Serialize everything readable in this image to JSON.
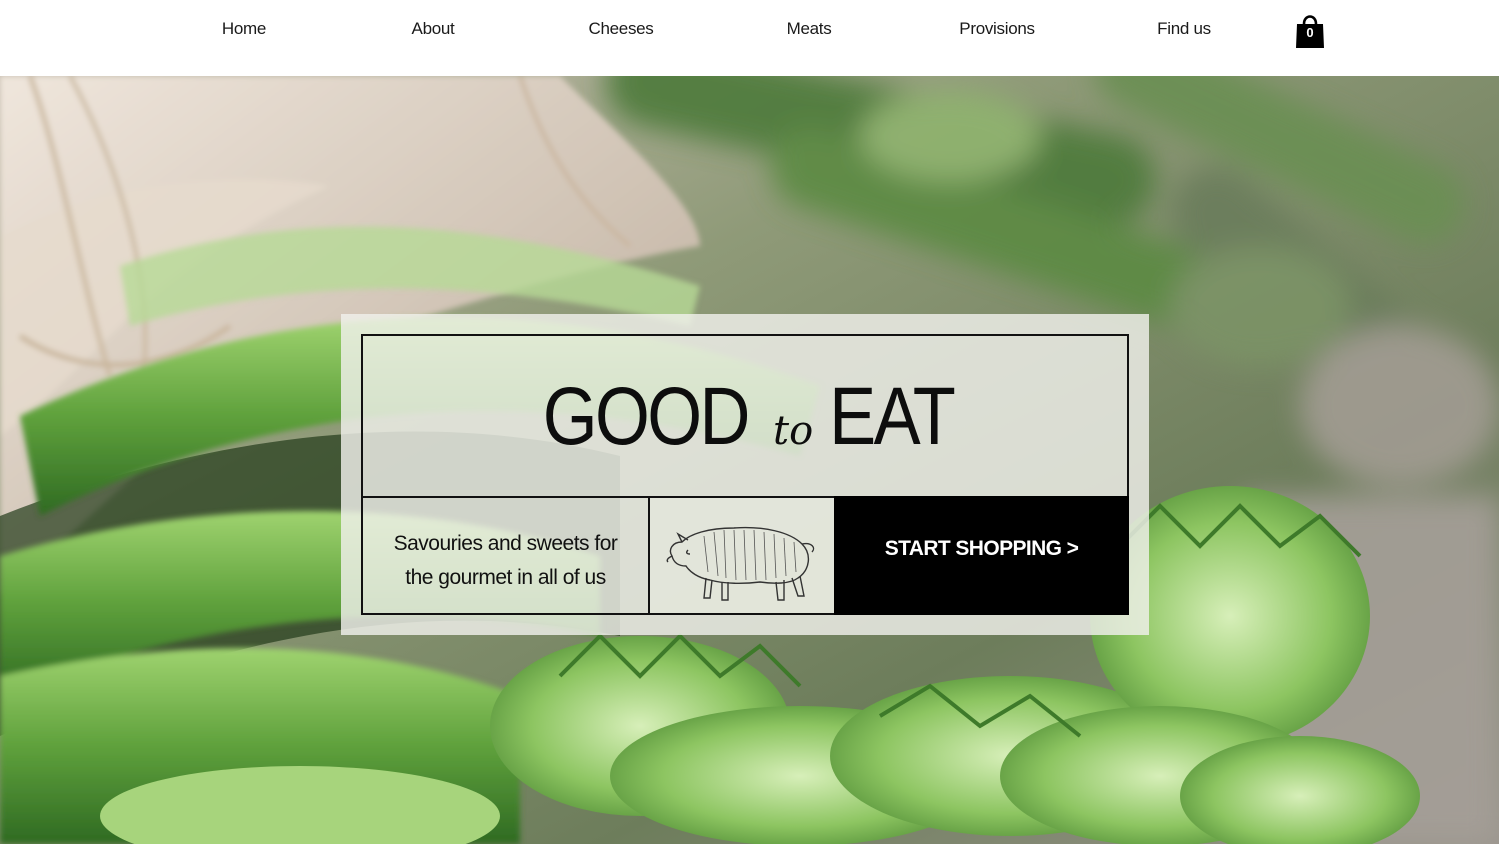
{
  "nav": {
    "items": [
      {
        "label": "Home"
      },
      {
        "label": "About"
      },
      {
        "label": "Cheeses"
      },
      {
        "label": "Meats"
      },
      {
        "label": "Provisions"
      },
      {
        "label": "Find us"
      }
    ],
    "cart": {
      "icon": "shopping-bag-icon",
      "count": "0"
    }
  },
  "hero": {
    "background": "asparagus-photo",
    "headline": {
      "left": "GOOD",
      "script": "to",
      "right": "EAT"
    },
    "tagline_line1": "Savouries and sweets for",
    "tagline_line2": "the gourmet in all of us",
    "illustration": "pig-engraving-icon",
    "cta_label": "START SHOPPING >"
  },
  "colors": {
    "nav_bg": "#ffffff",
    "nav_text": "#1a1a1a",
    "card_bg": "#f0f0ec",
    "cta_bg": "#000000",
    "cta_text": "#ffffff",
    "asparagus_green": "#6fb24a"
  }
}
